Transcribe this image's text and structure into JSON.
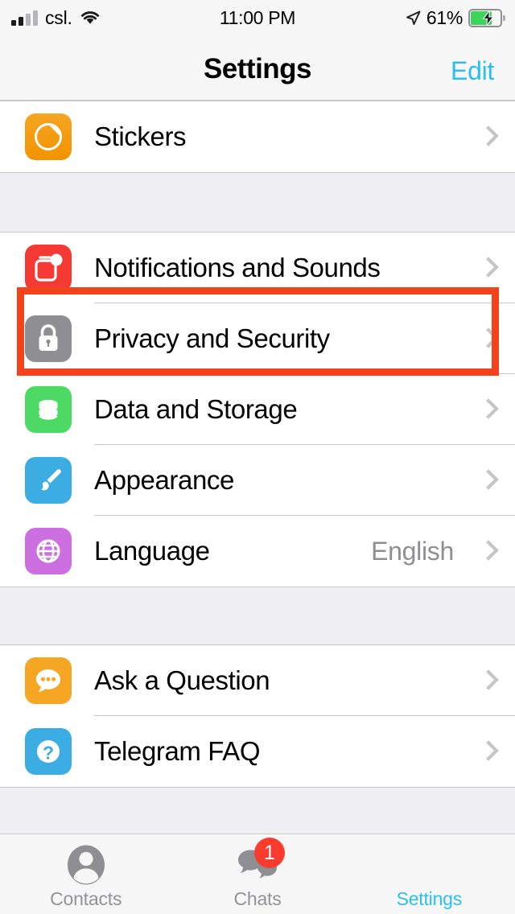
{
  "status_bar": {
    "carrier": "csl.",
    "signal_icon": "cellular-signal-icon",
    "wifi_icon": "wifi-icon",
    "time": "11:00 PM",
    "location_icon": "location-arrow-icon",
    "battery_percent": "61%",
    "battery_icon": "battery-charging-icon",
    "battery_level": 61,
    "battery_fill_color": "#3BD55A"
  },
  "nav": {
    "title": "Settings",
    "edit_label": "Edit",
    "accent_color": "#2BBFEF"
  },
  "sections": [
    {
      "id": "stickers-section",
      "rows": [
        {
          "id": "stickers",
          "label": "Stickers",
          "icon": "stickers-icon",
          "icon_color": "#F5A623",
          "value": "",
          "chevron": true
        }
      ]
    },
    {
      "id": "preferences-section",
      "rows": [
        {
          "id": "notifications-and-sounds",
          "label": "Notifications and Sounds",
          "icon": "notifications-icon",
          "icon_color": "#F43A33",
          "value": "",
          "chevron": true
        },
        {
          "id": "privacy-and-security",
          "label": "Privacy and Security",
          "icon": "lock-icon",
          "icon_color": "#8E8E93",
          "value": "",
          "chevron": true
        },
        {
          "id": "data-and-storage",
          "label": "Data and Storage",
          "icon": "database-icon",
          "icon_color": "#4CD964",
          "value": "",
          "chevron": true
        },
        {
          "id": "appearance",
          "label": "Appearance",
          "icon": "paintbrush-icon",
          "icon_color": "#3BADE3",
          "value": "",
          "chevron": true
        },
        {
          "id": "language",
          "label": "Language",
          "icon": "globe-icon",
          "icon_color": "#CC6FE0",
          "value": "English",
          "chevron": true
        }
      ]
    },
    {
      "id": "help-section",
      "rows": [
        {
          "id": "ask-a-question",
          "label": "Ask a Question",
          "icon": "speech-bubble-icon",
          "icon_color": "#F5A623",
          "value": "",
          "chevron": true
        },
        {
          "id": "telegram-faq",
          "label": "Telegram FAQ",
          "icon": "question-mark-icon",
          "icon_color": "#3BADE3",
          "value": "",
          "chevron": true
        }
      ]
    }
  ],
  "highlight": {
    "target_row": "privacy-and-security",
    "color": "#F4431C"
  },
  "tab_bar": {
    "items": [
      {
        "id": "contacts",
        "label": "Contacts",
        "icon": "person-icon",
        "active": false,
        "badge": ""
      },
      {
        "id": "chats",
        "label": "Chats",
        "icon": "chats-icon",
        "active": false,
        "badge": "1"
      },
      {
        "id": "settings",
        "label": "Settings",
        "icon": "settings-icon",
        "active": true,
        "badge": ""
      }
    ],
    "active_color": "#2BBFEF",
    "inactive_color": "#929297"
  }
}
